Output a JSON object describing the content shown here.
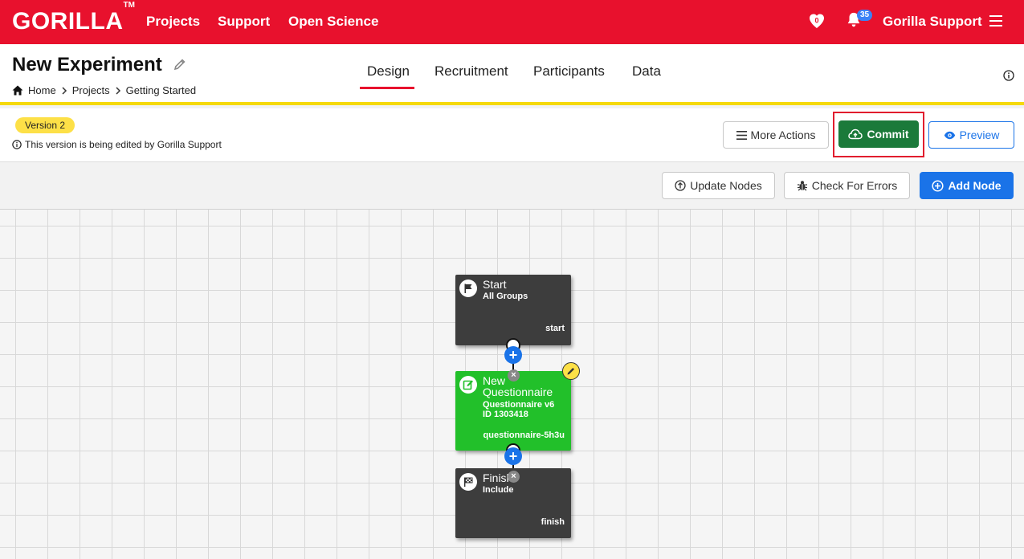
{
  "topnav": {
    "brand": "GORILLA",
    "brand_tm": "TM",
    "links": [
      "Projects",
      "Support",
      "Open Science"
    ],
    "heart_count": "0",
    "notification_count": "35",
    "user": "Gorilla Support",
    "accent": "#e8112d"
  },
  "experiment": {
    "title": "New Experiment",
    "breadcrumb": [
      "Home",
      "Projects",
      "Getting Started"
    ],
    "tabs": [
      "Design",
      "Recruitment",
      "Participants",
      "Data"
    ],
    "active_tab": "Design"
  },
  "version": {
    "badge": "Version 2",
    "note": "This version is being edited by Gorilla Support"
  },
  "actions": {
    "more_actions": "More Actions",
    "commit": "Commit",
    "preview": "Preview",
    "update_nodes": "Update Nodes",
    "check_errors": "Check For Errors",
    "add_node": "Add Node"
  },
  "nodes": {
    "start": {
      "title": "Start",
      "sub": "All Groups",
      "foot": "start",
      "icon": "flag-icon"
    },
    "questionnaire": {
      "title": "New Questionnaire",
      "sub1": "Questionnaire v6",
      "sub2": "ID 1303418",
      "foot": "questionnaire-5h3u",
      "icon": "edit-square-icon",
      "color": "#22c02a"
    },
    "finish": {
      "title": "Finish",
      "sub": "Include",
      "foot": "finish",
      "icon": "checkered-flag-icon"
    }
  }
}
